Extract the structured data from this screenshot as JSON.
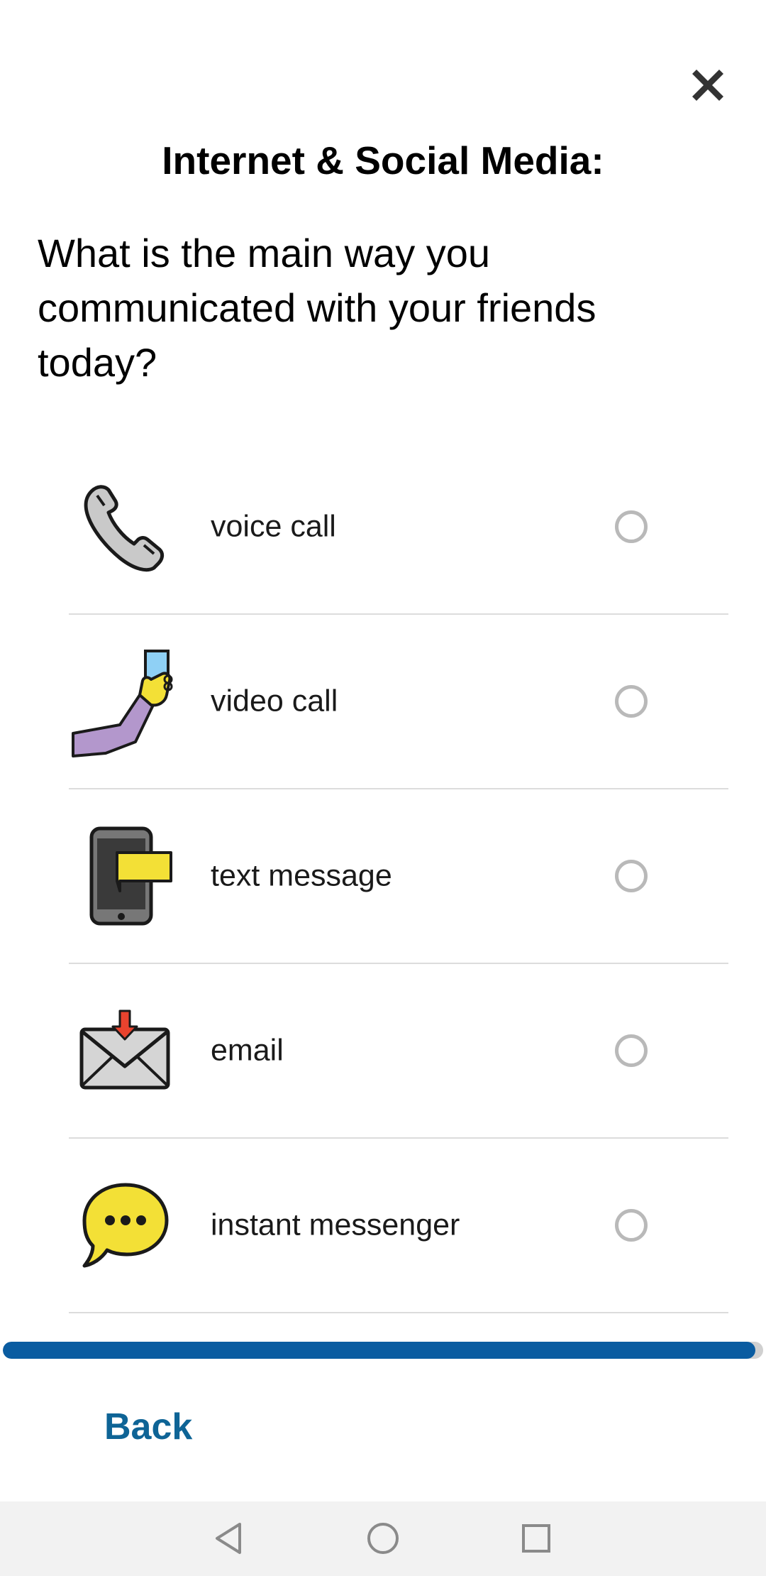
{
  "header": {
    "close_icon": "close-icon",
    "section_title": "Internet & Social Media:"
  },
  "question": {
    "text": "What is the main way you communicated with your friends today?"
  },
  "options": [
    {
      "label": "voice call",
      "icon": "telephone-handset-icon",
      "selected": false
    },
    {
      "label": "video call",
      "icon": "hand-holding-phone-icon",
      "selected": false
    },
    {
      "label": "text message",
      "icon": "phone-with-message-icon",
      "selected": false
    },
    {
      "label": "email",
      "icon": "envelope-incoming-icon",
      "selected": false
    },
    {
      "label": "instant messenger",
      "icon": "speech-bubble-icon",
      "selected": false
    }
  ],
  "progress": {
    "value": 0.99,
    "fill_color": "#0a5ca1"
  },
  "footer": {
    "back_label": "Back",
    "back_color": "#0e6496"
  },
  "system_nav": {
    "back_icon": "nav-back-icon",
    "home_icon": "nav-home-icon",
    "recents_icon": "nav-recents-icon"
  }
}
